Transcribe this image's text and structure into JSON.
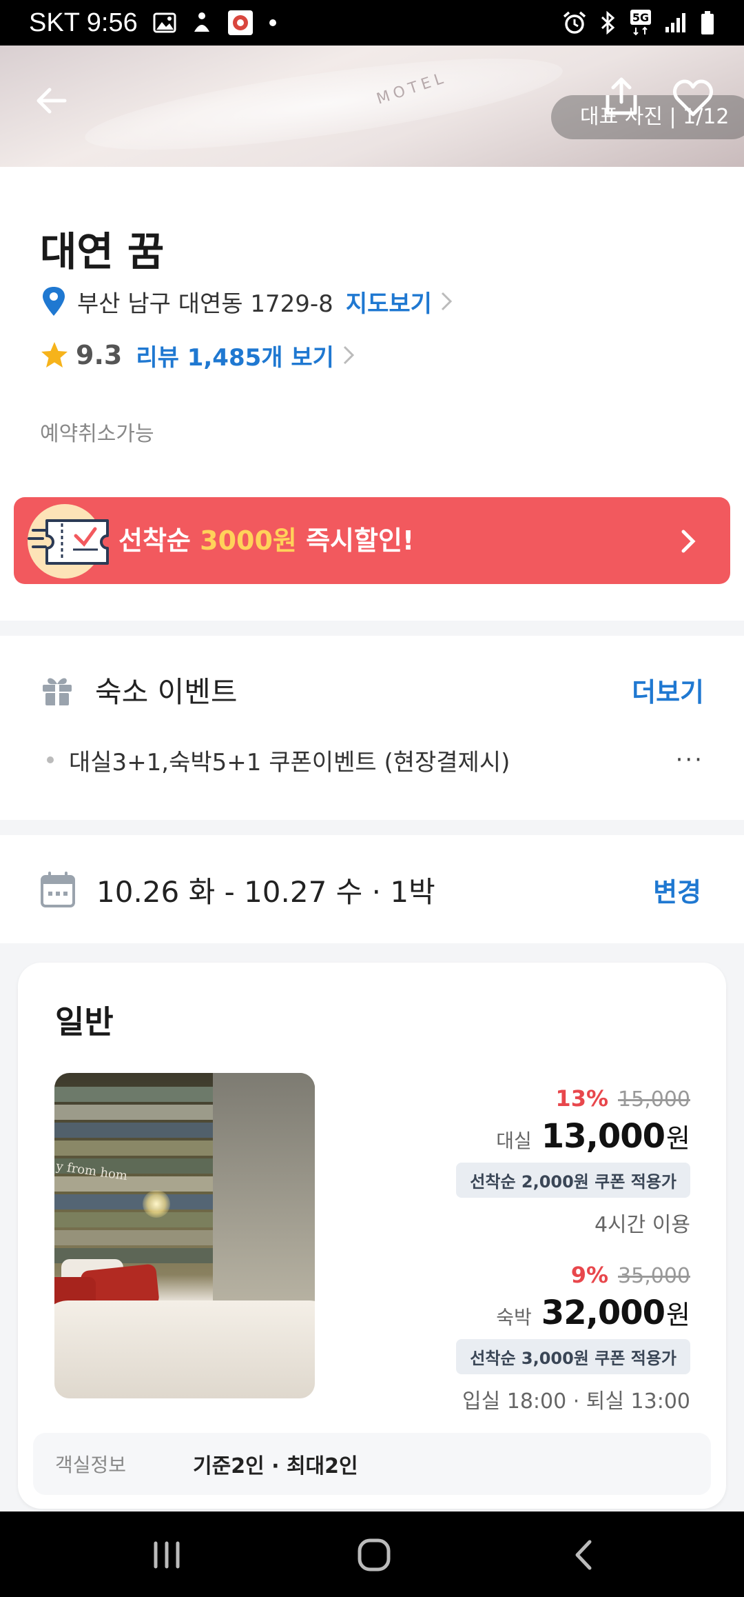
{
  "status_bar": {
    "carrier_time": "SKT 9:56",
    "icons_left": [
      "gallery-icon",
      "app-icon",
      "app-icon-2",
      "dot-icon"
    ],
    "icons_right": [
      "alarm-icon",
      "bluetooth-icon",
      "5g-icon",
      "signal-icon",
      "battery-icon"
    ]
  },
  "hero": {
    "photo_label": "대표 사진 | 1/12",
    "logo_text": "MOTEL"
  },
  "hotel": {
    "name": "대연 꿈",
    "address": "부산 남구 대연동 1729-8",
    "map_link": "지도보기",
    "rating": "9.3",
    "review_link": "리뷰 1,485개 보기",
    "cancel_policy": "예약취소가능"
  },
  "banner": {
    "text_before": "선착순 ",
    "text_highlight": "3000원",
    "text_after": " 즉시할인!"
  },
  "event": {
    "title": "숙소 이벤트",
    "more": "더보기",
    "item": "대실3+1,숙박5+1 쿠폰이벤트 (현장결제시)",
    "ellipsis": "···"
  },
  "dates": {
    "text": "10.26 화 - 10.27 수 · 1박",
    "change": "변경"
  },
  "room": {
    "title": "일반",
    "photo_wall_text": "y from hom",
    "rest": {
      "discount": "13%",
      "original": "15,000",
      "type": "대실",
      "price": "13,000",
      "won": "원",
      "coupon": "선착순 2,000원 쿠폰 적용가",
      "usage": "4시간 이용"
    },
    "stay": {
      "discount": "9%",
      "original": "35,000",
      "type": "숙박",
      "price": "32,000",
      "won": "원",
      "coupon": "선착순 3,000원 쿠폰 적용가",
      "usage": "입실 18:00 · 퇴실 13:00"
    },
    "info_label": "객실정보",
    "info_value": "기준2인 · 최대2인"
  },
  "colors": {
    "accent_blue": "#1f78d1",
    "banner_red": "#f2595e",
    "discount_red": "#e8474c",
    "highlight_yellow": "#ffd25a",
    "star_yellow": "#f6b31b"
  }
}
